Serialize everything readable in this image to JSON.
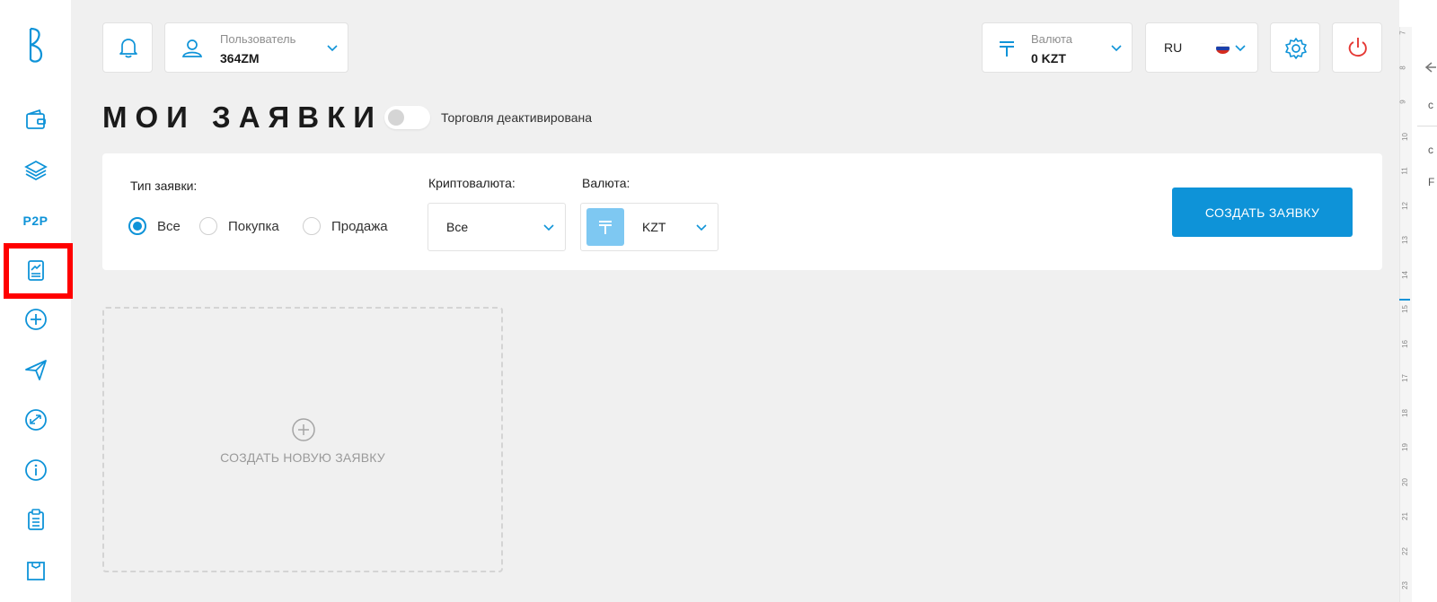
{
  "sidebar": {
    "items": [
      {
        "name": "wallet-icon"
      },
      {
        "name": "layers-icon"
      },
      {
        "label": "P2P"
      },
      {
        "name": "chart-doc-icon"
      },
      {
        "name": "plus-circle-icon"
      },
      {
        "name": "send-icon"
      },
      {
        "name": "exchange-icon"
      },
      {
        "name": "info-icon"
      },
      {
        "name": "clipboard-icon"
      },
      {
        "name": "bag-icon"
      }
    ]
  },
  "header": {
    "user_label": "Пользователь",
    "user_value": "364ZM",
    "currency_label": "Валюта",
    "currency_value": "0 KZT",
    "lang": "RU"
  },
  "page": {
    "title": "МОИ ЗАЯВКИ",
    "toggle_label": "Торговля деактивирована"
  },
  "filters": {
    "type_label": "Тип заявки:",
    "types": [
      "Все",
      "Покупка",
      "Продажа"
    ],
    "selected_type": "Все",
    "crypto_label": "Криптовалюта:",
    "crypto_value": "Все",
    "currency_label": "Валюта:",
    "currency_value": "KZT",
    "create_button": "СОЗДАТЬ ЗАЯВКУ"
  },
  "new_order": {
    "label": "СОЗДАТЬ НОВУЮ ЗАЯВКУ"
  },
  "right_panel": {
    "ruler": [
      "7",
      "8",
      "9",
      "10",
      "11",
      "12",
      "13",
      "14",
      "15",
      "16",
      "17",
      "18",
      "19",
      "20",
      "21",
      "22",
      "23"
    ],
    "texts": [
      "c",
      "c",
      "F"
    ]
  },
  "colors": {
    "accent": "#0e93d8",
    "highlight": "#ff0000",
    "power": "#e53935"
  }
}
